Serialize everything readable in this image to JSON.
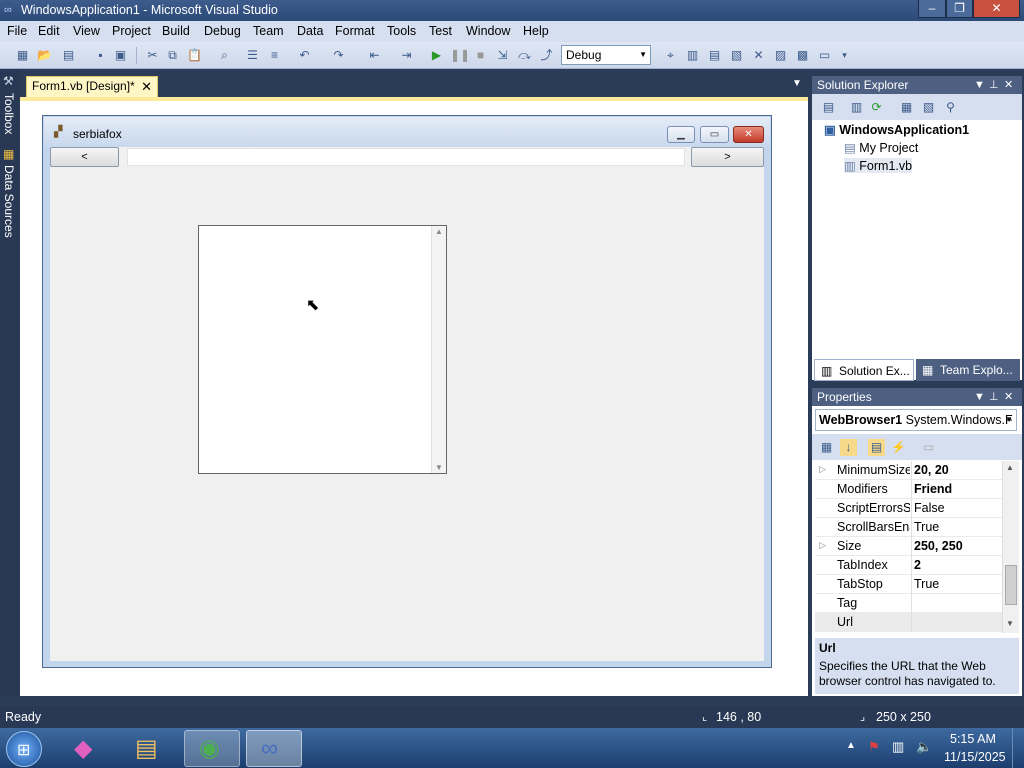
{
  "window": {
    "title": "WindowsApplication1 - Microsoft Visual Studio",
    "icon": "vs-infinity-icon"
  },
  "menu": [
    "File",
    "Edit",
    "View",
    "Project",
    "Build",
    "Debug",
    "Team",
    "Data",
    "Format",
    "Tools",
    "Test",
    "Window",
    "Help"
  ],
  "toolbar": {
    "configuration": "Debug"
  },
  "left_rail": {
    "toolbox": "Toolbox",
    "data_sources": "Data Sources"
  },
  "doc_tab": {
    "label": "Form1.vb [Design]*"
  },
  "form": {
    "title": "serbiafox",
    "back_label": "<",
    "forward_label": ">",
    "url_value": ""
  },
  "solution_explorer": {
    "title": "Solution Explorer",
    "items": [
      "WindowsApplication1",
      "My Project",
      "Form1.vb"
    ],
    "tabs": [
      "Solution Ex...",
      "Team Explo..."
    ]
  },
  "properties": {
    "title": "Properties",
    "object_name": "WebBrowser1",
    "object_type": "System.Windows.F",
    "rows": [
      {
        "name": "MinimumSize",
        "value": "20, 20",
        "bold": true,
        "expandable": true
      },
      {
        "name": "Modifiers",
        "value": "Friend",
        "bold": true,
        "expandable": false
      },
      {
        "name": "ScriptErrorsSu",
        "value": "False",
        "bold": false,
        "expandable": false
      },
      {
        "name": "ScrollBarsEnal",
        "value": "True",
        "bold": false,
        "expandable": false
      },
      {
        "name": "Size",
        "value": "250, 250",
        "bold": true,
        "expandable": true
      },
      {
        "name": "TabIndex",
        "value": "2",
        "bold": true,
        "expandable": false
      },
      {
        "name": "TabStop",
        "value": "True",
        "bold": false,
        "expandable": false
      },
      {
        "name": "Tag",
        "value": "",
        "bold": false,
        "expandable": false
      },
      {
        "name": "Url",
        "value": "",
        "bold": false,
        "expandable": false
      }
    ],
    "description_title": "Url",
    "description_text": "Specifies the URL that the Web browser control has navigated to."
  },
  "status": {
    "text": "Ready",
    "position": "146 , 80",
    "size": "250 x 250"
  },
  "taskbar": {
    "time": "5:15 AM",
    "date": "11/15/2025"
  }
}
